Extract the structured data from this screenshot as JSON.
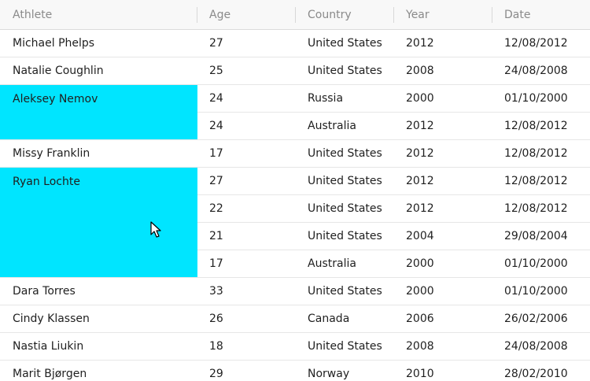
{
  "columns": [
    "Athlete",
    "Age",
    "Country",
    "Year",
    "Date"
  ],
  "rows": [
    {
      "athlete": "Michael Phelps",
      "age": "27",
      "country": "United States",
      "year": "2012",
      "date": "12/08/2012"
    },
    {
      "athlete": "Natalie Coughlin",
      "age": "25",
      "country": "United States",
      "year": "2008",
      "date": "24/08/2008"
    },
    {
      "athlete": "Aleksey Nemov",
      "age": "24",
      "country": "Russia",
      "year": "2000",
      "date": "01/10/2000"
    },
    {
      "athlete": "",
      "age": "24",
      "country": "Australia",
      "year": "2012",
      "date": "12/08/2012"
    },
    {
      "athlete": "Missy Franklin",
      "age": "17",
      "country": "United States",
      "year": "2012",
      "date": "12/08/2012"
    },
    {
      "athlete": "Ryan Lochte",
      "age": "27",
      "country": "United States",
      "year": "2012",
      "date": "12/08/2012"
    },
    {
      "athlete": "",
      "age": "22",
      "country": "United States",
      "year": "2012",
      "date": "12/08/2012"
    },
    {
      "athlete": "",
      "age": "21",
      "country": "United States",
      "year": "2004",
      "date": "29/08/2004"
    },
    {
      "athlete": "",
      "age": "17",
      "country": "Australia",
      "year": "2000",
      "date": "01/10/2000"
    },
    {
      "athlete": "Dara Torres",
      "age": "33",
      "country": "United States",
      "year": "2000",
      "date": "01/10/2000"
    },
    {
      "athlete": "Cindy Klassen",
      "age": "26",
      "country": "Canada",
      "year": "2006",
      "date": "26/02/2006"
    },
    {
      "athlete": "Nastia Liukin",
      "age": "18",
      "country": "United States",
      "year": "2008",
      "date": "24/08/2008"
    },
    {
      "athlete": "Marit Bjørgen",
      "age": "29",
      "country": "Norway",
      "year": "2010",
      "date": "28/02/2010"
    }
  ],
  "spanned": [
    {
      "row": 2,
      "rowspan": 2
    },
    {
      "row": 5,
      "rowspan": 4
    }
  ],
  "colors": {
    "highlight": "#00e5ff",
    "header_text": "#8a8a8a",
    "row_border": "#e6e6e6"
  },
  "icons": {
    "cursor": "mouse-pointer-icon"
  }
}
